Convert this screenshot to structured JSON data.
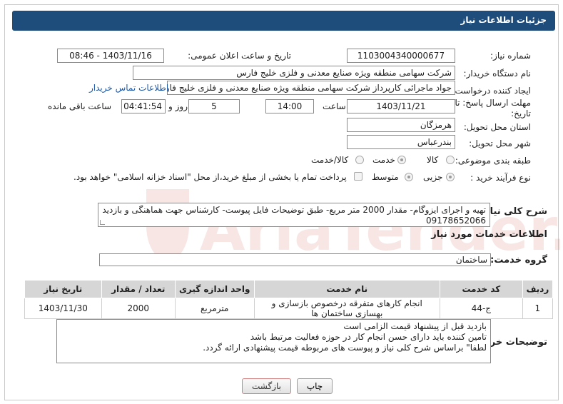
{
  "header": {
    "title": "جزئیات اطلاعات نیاز"
  },
  "fields": {
    "need_number_label": "شماره نیاز:",
    "need_number": "1103004340000677",
    "announce_label": "تاریخ و ساعت اعلان عمومی:",
    "announce_value": "1403/11/16 - 08:46",
    "buyer_label": "نام دستگاه خریدار:",
    "buyer_value": "شرکت سهامی منطقه ویژه صنایع معدنی و فلزی خلیج فارس",
    "creator_label": "ایجاد کننده درخواست:",
    "creator_value": "جواد ماجرائی کارپرداز شرکت سهامی منطقه ویژه صنایع معدنی و فلزی خلیج فار",
    "contact_link": "اطلاعات تماس خریدار",
    "deadline_label_1": "مهلت ارسال پاسخ: تا",
    "deadline_label_2": "تاریخ:",
    "deadline_date": "1403/11/21",
    "time_label": "ساعت",
    "deadline_time": "14:00",
    "days_value": "5",
    "days_label": "روز و",
    "remain_time": "04:41:54",
    "remain_label": "ساعت باقی مانده",
    "province_label": "استان محل تحویل:",
    "province_value": "هرمزگان",
    "city_label": "شهر محل تحویل:",
    "city_value": "بندرعباس",
    "category_label": "طبقه بندی موضوعی:",
    "cat_goods": "کالا",
    "cat_service": "خدمت",
    "cat_goods_service": "کالا/خدمت",
    "process_label": "نوع فرآیند خرید :",
    "proc_partial": "جزیی",
    "proc_medium": "متوسط",
    "payment_note": "پرداخت تمام یا بخشی از مبلغ خرید،از محل \"اسناد خزانه اسلامی\" خواهد بود."
  },
  "description": {
    "label": "شرح کلی نیاز:",
    "text": "تهیه و اجرای ایزوگام- مقدار 2000 متر مربع- طبق توضیحات فایل پیوست- کارشناس جهت هماهنگی و بازدید 09178652066"
  },
  "services": {
    "section_title": "اطلاعات خدمات مورد نیاز",
    "group_label": "گروه خدمت:",
    "group_value": "ساختمان",
    "columns": [
      "ردیف",
      "کد خدمت",
      "نام خدمت",
      "واحد اندازه گیری",
      "تعداد / مقدار",
      "تاریخ نیاز"
    ],
    "rows": [
      [
        "1",
        "ج-44",
        "انجام کارهای متفرقه درخصوص بازسازی و بهسازی ساختمان ها",
        "مترمربع",
        "2000",
        "1403/11/30"
      ]
    ]
  },
  "buyer_notes": {
    "label": "توضیحات خریدار:",
    "lines": [
      "بازدید قبل از پیشنهاد قیمت الزامی است",
      "تامین کننده باید دارای حسن انجام کار در حوزه فعالیت مرتبط باشد",
      "لطفا\" براساس شرح کلی نیاز و پیوست های مربوطه قیمت پیشنهادی ارائه گردد."
    ]
  },
  "buttons": {
    "print": "چاپ",
    "back": "بازگشت"
  },
  "watermark": {
    "text": "AriaTender.neT"
  },
  "colors": {
    "header_bg": "#1e4c7b",
    "link": "#1e5aa8",
    "watermark": "#c0392b"
  }
}
